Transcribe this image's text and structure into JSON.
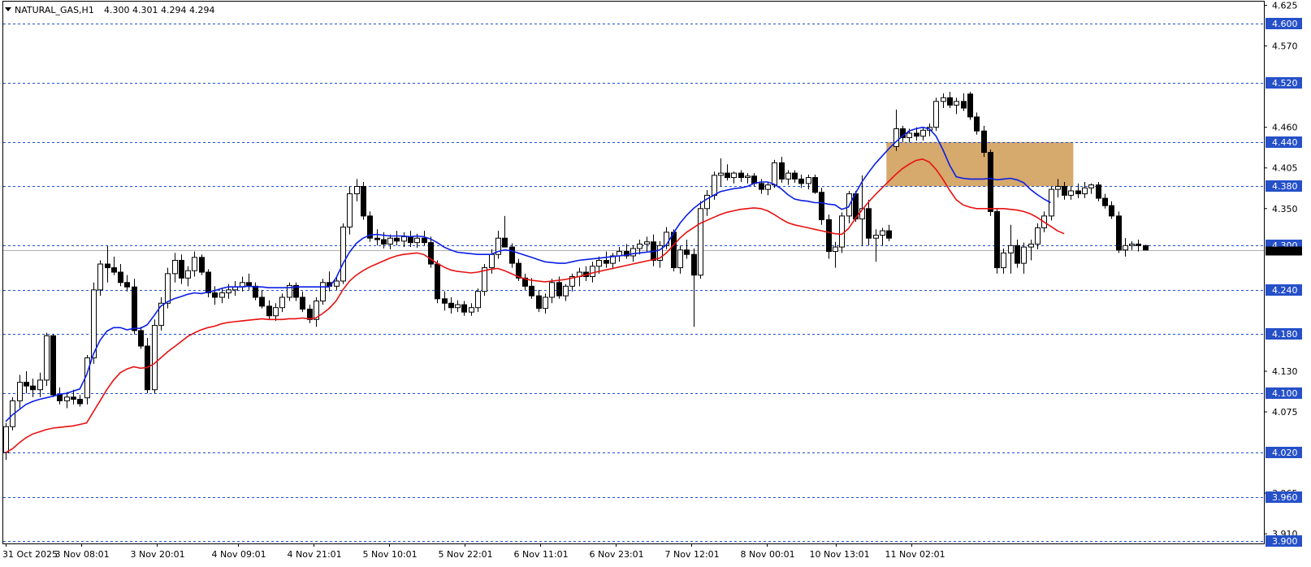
{
  "header": {
    "symbol_label": "NATURAL_GAS,H1",
    "ohlc_label": "4.300 4.301 4.294 4.294",
    "menu_icon": "triangle-down-icon"
  },
  "chart_data": {
    "type": "candlestick",
    "symbol": "NATURAL_GAS",
    "timeframe": "H1",
    "last_ohlc": {
      "open": 4.3,
      "high": 4.301,
      "low": 4.294,
      "close": 4.294
    },
    "ylim": [
      3.897,
      4.63
    ],
    "y_ticks": [
      "4.625",
      "4.570",
      "4.460",
      "4.405",
      "4.350",
      "4.130",
      "4.075",
      "3.965",
      "3.910"
    ],
    "x_ticks": [
      "31 Oct 2025",
      "3 Nov 08:01",
      "3 Nov 20:01",
      "4 Nov 09:01",
      "4 Nov 21:01",
      "5 Nov 10:01",
      "5 Nov 22:01",
      "6 Nov 11:01",
      "6 Nov 23:01",
      "7 Nov 12:01",
      "8 Nov 00:01",
      "10 Nov 13:01",
      "11 Nov 02:01"
    ],
    "hlines": [
      {
        "price": 4.6,
        "label": "4.600"
      },
      {
        "price": 4.52,
        "label": "4.520"
      },
      {
        "price": 4.44,
        "label": "4.440"
      },
      {
        "price": 4.38,
        "label": "4.380"
      },
      {
        "price": 4.3,
        "label": "4.300"
      },
      {
        "price": 4.24,
        "label": "4.240"
      },
      {
        "price": 4.18,
        "label": "4.180"
      },
      {
        "price": 4.1,
        "label": "4.100"
      },
      {
        "price": 4.02,
        "label": "4.020"
      },
      {
        "price": 3.96,
        "label": "3.960"
      },
      {
        "price": 3.9,
        "label": "3.900"
      }
    ],
    "current_price": 4.294,
    "zone": {
      "bar_start": 131,
      "bar_end": 158,
      "price_low": 4.38,
      "price_high": 4.44,
      "color": "#d6a96c"
    },
    "candles": [
      [
        4.02,
        4.06,
        4.01,
        4.055
      ],
      [
        4.055,
        4.095,
        4.05,
        4.09
      ],
      [
        4.09,
        4.125,
        4.08,
        4.115
      ],
      [
        4.115,
        4.13,
        4.1,
        4.11
      ],
      [
        4.11,
        4.12,
        4.095,
        4.105
      ],
      [
        4.105,
        4.128,
        4.095,
        4.118
      ],
      [
        4.118,
        4.182,
        4.11,
        4.178
      ],
      [
        4.178,
        4.18,
        4.095,
        4.098
      ],
      [
        4.098,
        4.108,
        4.085,
        4.09
      ],
      [
        4.09,
        4.102,
        4.08,
        4.095
      ],
      [
        4.095,
        4.105,
        4.085,
        4.092
      ],
      [
        4.092,
        4.098,
        4.082,
        4.086
      ],
      [
        4.094,
        4.152,
        4.085,
        4.148
      ],
      [
        4.148,
        4.25,
        4.14,
        4.24
      ],
      [
        4.24,
        4.28,
        4.232,
        4.275
      ],
      [
        4.275,
        4.3,
        4.25,
        4.27
      ],
      [
        4.27,
        4.285,
        4.26,
        4.264
      ],
      [
        4.264,
        4.275,
        4.245,
        4.25
      ],
      [
        4.25,
        4.26,
        4.238,
        4.244
      ],
      [
        4.244,
        4.255,
        4.18,
        4.185
      ],
      [
        4.185,
        4.19,
        4.16,
        4.164
      ],
      [
        4.164,
        4.175,
        4.1,
        4.105
      ],
      [
        4.105,
        4.2,
        4.1,
        4.192
      ],
      [
        4.192,
        4.23,
        4.185,
        4.222
      ],
      [
        4.222,
        4.27,
        4.215,
        4.262
      ],
      [
        4.262,
        4.29,
        4.25,
        4.28
      ],
      [
        4.28,
        4.288,
        4.248,
        4.256
      ],
      [
        4.256,
        4.272,
        4.245,
        4.266
      ],
      [
        4.266,
        4.292,
        4.258,
        4.284
      ],
      [
        4.284,
        4.288,
        4.26,
        4.264
      ],
      [
        4.264,
        4.268,
        4.23,
        4.236
      ],
      [
        4.236,
        4.245,
        4.22,
        4.23
      ],
      [
        4.23,
        4.242,
        4.222,
        4.236
      ],
      [
        4.236,
        4.248,
        4.228,
        4.24
      ],
      [
        4.24,
        4.252,
        4.232,
        4.244
      ],
      [
        4.244,
        4.258,
        4.238,
        4.25
      ],
      [
        4.25,
        4.262,
        4.24,
        4.245
      ],
      [
        4.245,
        4.25,
        4.226,
        4.23
      ],
      [
        4.23,
        4.24,
        4.215,
        4.218
      ],
      [
        4.218,
        4.226,
        4.2,
        4.205
      ],
      [
        4.205,
        4.222,
        4.198,
        4.216
      ],
      [
        4.216,
        4.235,
        4.21,
        4.23
      ],
      [
        4.23,
        4.25,
        4.225,
        4.246
      ],
      [
        4.246,
        4.25,
        4.225,
        4.23
      ],
      [
        4.23,
        4.238,
        4.21,
        4.214
      ],
      [
        4.214,
        4.22,
        4.195,
        4.2
      ],
      [
        4.2,
        4.23,
        4.19,
        4.225
      ],
      [
        4.225,
        4.255,
        4.22,
        4.25
      ],
      [
        4.25,
        4.265,
        4.238,
        4.245
      ],
      [
        4.245,
        4.258,
        4.24,
        4.252
      ],
      [
        4.252,
        4.33,
        4.248,
        4.325
      ],
      [
        4.325,
        4.38,
        4.315,
        4.37
      ],
      [
        4.37,
        4.39,
        4.36,
        4.38
      ],
      [
        4.38,
        4.386,
        4.335,
        4.34
      ],
      [
        4.34,
        4.346,
        4.305,
        4.31
      ],
      [
        4.31,
        4.322,
        4.3,
        4.308
      ],
      [
        4.308,
        4.318,
        4.296,
        4.302
      ],
      [
        4.302,
        4.315,
        4.295,
        4.31
      ],
      [
        4.31,
        4.32,
        4.3,
        4.306
      ],
      [
        4.306,
        4.318,
        4.298,
        4.312
      ],
      [
        4.312,
        4.32,
        4.298,
        4.304
      ],
      [
        4.304,
        4.316,
        4.297,
        4.31
      ],
      [
        4.31,
        4.32,
        4.3,
        4.304
      ],
      [
        4.304,
        4.312,
        4.27,
        4.275
      ],
      [
        4.275,
        4.28,
        4.222,
        4.228
      ],
      [
        4.228,
        4.238,
        4.212,
        4.222
      ],
      [
        4.222,
        4.23,
        4.208,
        4.216
      ],
      [
        4.216,
        4.226,
        4.21,
        4.22
      ],
      [
        4.22,
        4.225,
        4.205,
        4.21
      ],
      [
        4.21,
        4.222,
        4.205,
        4.216
      ],
      [
        4.216,
        4.242,
        4.21,
        4.238
      ],
      [
        4.238,
        4.275,
        4.232,
        4.27
      ],
      [
        4.27,
        4.295,
        4.262,
        4.288
      ],
      [
        4.288,
        4.32,
        4.282,
        4.31
      ],
      [
        4.31,
        4.34,
        4.3,
        4.298
      ],
      [
        4.298,
        4.303,
        4.27,
        4.276
      ],
      [
        4.276,
        4.282,
        4.252,
        4.256
      ],
      [
        4.256,
        4.262,
        4.24,
        4.245
      ],
      [
        4.245,
        4.256,
        4.228,
        4.232
      ],
      [
        4.232,
        4.24,
        4.21,
        4.215
      ],
      [
        4.215,
        4.235,
        4.208,
        4.23
      ],
      [
        4.23,
        4.255,
        4.222,
        4.25
      ],
      [
        4.25,
        4.258,
        4.228,
        4.232
      ],
      [
        4.232,
        4.248,
        4.225,
        4.245
      ],
      [
        4.245,
        4.262,
        4.238,
        4.258
      ],
      [
        4.258,
        4.27,
        4.245,
        4.264
      ],
      [
        4.264,
        4.272,
        4.252,
        4.258
      ],
      [
        4.258,
        4.278,
        4.25,
        4.272
      ],
      [
        4.272,
        4.285,
        4.262,
        4.28
      ],
      [
        4.28,
        4.292,
        4.27,
        4.276
      ],
      [
        4.276,
        4.29,
        4.268,
        4.286
      ],
      [
        4.286,
        4.298,
        4.278,
        4.292
      ],
      [
        4.292,
        4.302,
        4.282,
        4.286
      ],
      [
        4.286,
        4.3,
        4.278,
        4.296
      ],
      [
        4.296,
        4.308,
        4.288,
        4.302
      ],
      [
        4.302,
        4.312,
        4.292,
        4.305
      ],
      [
        4.305,
        4.315,
        4.272,
        4.28
      ],
      [
        4.28,
        4.306,
        4.27,
        4.3
      ],
      [
        4.3,
        4.325,
        4.295,
        4.318
      ],
      [
        4.318,
        4.322,
        4.265,
        4.27
      ],
      [
        4.27,
        4.3,
        4.262,
        4.294
      ],
      [
        4.294,
        4.308,
        4.282,
        4.288
      ],
      [
        4.288,
        4.296,
        4.19,
        4.26
      ],
      [
        4.26,
        4.36,
        4.255,
        4.35
      ],
      [
        4.35,
        4.375,
        4.34,
        4.368
      ],
      [
        4.368,
        4.4,
        4.362,
        4.395
      ],
      [
        4.395,
        4.418,
        4.38,
        4.398
      ],
      [
        4.398,
        4.41,
        4.388,
        4.392
      ],
      [
        4.392,
        4.4,
        4.384,
        4.398
      ],
      [
        4.398,
        4.402,
        4.386,
        4.392
      ],
      [
        4.392,
        4.398,
        4.384,
        4.394
      ],
      [
        4.394,
        4.398,
        4.38,
        4.384
      ],
      [
        4.384,
        4.39,
        4.37,
        4.376
      ],
      [
        4.376,
        4.386,
        4.368,
        4.382
      ],
      [
        4.382,
        4.416,
        4.378,
        4.412
      ],
      [
        4.412,
        4.42,
        4.385,
        4.39
      ],
      [
        4.39,
        4.402,
        4.382,
        4.398
      ],
      [
        4.398,
        4.402,
        4.385,
        4.39
      ],
      [
        4.39,
        4.396,
        4.378,
        4.384
      ],
      [
        4.384,
        4.396,
        4.376,
        4.392
      ],
      [
        4.392,
        4.396,
        4.37,
        4.372
      ],
      [
        4.372,
        4.378,
        4.328,
        4.335
      ],
      [
        4.335,
        4.342,
        4.282,
        4.292
      ],
      [
        4.292,
        4.305,
        4.27,
        4.298
      ],
      [
        4.298,
        4.345,
        4.29,
        4.34
      ],
      [
        4.34,
        4.374,
        4.33,
        4.37
      ],
      [
        4.37,
        4.374,
        4.332,
        4.336
      ],
      [
        4.336,
        4.395,
        4.3,
        4.35
      ],
      [
        4.35,
        4.362,
        4.3,
        4.31
      ],
      [
        4.31,
        4.322,
        4.278,
        4.314
      ],
      [
        4.314,
        4.324,
        4.3,
        4.32
      ],
      [
        4.32,
        4.328,
        4.306,
        4.31
      ],
      [
        4.434,
        4.484,
        4.428,
        4.458
      ],
      [
        4.458,
        4.462,
        4.44,
        4.446
      ],
      [
        4.446,
        4.458,
        4.44,
        4.452
      ],
      [
        4.452,
        4.46,
        4.442,
        4.448
      ],
      [
        4.448,
        4.46,
        4.442,
        4.456
      ],
      [
        4.456,
        4.465,
        4.448,
        4.46
      ],
      [
        4.46,
        4.5,
        4.455,
        4.495
      ],
      [
        4.495,
        4.506,
        4.486,
        4.5
      ],
      [
        4.5,
        4.508,
        4.486,
        4.49
      ],
      [
        4.49,
        4.5,
        4.478,
        4.495
      ],
      [
        4.495,
        4.506,
        4.482,
        4.486
      ],
      [
        4.505,
        4.508,
        4.47,
        4.474
      ],
      [
        4.474,
        4.48,
        4.45,
        4.455
      ],
      [
        4.455,
        4.462,
        4.42,
        4.426
      ],
      [
        4.426,
        4.43,
        4.34,
        4.346
      ],
      [
        4.346,
        4.35,
        4.262,
        4.27
      ],
      [
        4.27,
        4.296,
        4.262,
        4.29
      ],
      [
        4.29,
        4.328,
        4.262,
        4.3
      ],
      [
        4.3,
        4.308,
        4.27,
        4.276
      ],
      [
        4.276,
        4.304,
        4.262,
        4.298
      ],
      [
        4.298,
        4.308,
        4.28,
        4.302
      ],
      [
        4.302,
        4.33,
        4.295,
        4.324
      ],
      [
        4.324,
        4.346,
        4.318,
        4.34
      ],
      [
        4.34,
        4.38,
        4.334,
        4.376
      ],
      [
        4.376,
        4.39,
        4.365,
        4.38
      ],
      [
        4.38,
        4.386,
        4.362,
        4.368
      ],
      [
        4.368,
        4.38,
        4.362,
        4.374
      ],
      [
        4.374,
        4.384,
        4.364,
        4.37
      ],
      [
        4.37,
        4.386,
        4.364,
        4.378
      ],
      [
        4.378,
        4.384,
        4.37,
        4.382
      ],
      [
        4.382,
        4.386,
        4.36,
        4.364
      ],
      [
        4.364,
        4.37,
        4.35,
        4.354
      ],
      [
        4.354,
        4.36,
        4.336,
        4.34
      ],
      [
        4.34,
        4.346,
        4.29,
        4.294
      ],
      [
        4.294,
        4.31,
        4.285,
        4.3
      ],
      [
        4.3,
        4.306,
        4.294,
        4.302
      ],
      [
        4.302,
        4.308,
        4.292,
        4.3
      ],
      [
        4.3,
        4.301,
        4.294,
        4.294
      ]
    ],
    "series": [
      {
        "name": "",
        "color": "#0a1ee6",
        "values": [
          4.062,
          4.071,
          4.078,
          4.085,
          4.089,
          4.092,
          4.094,
          4.096,
          4.099,
          4.1,
          4.103,
          4.106,
          4.125,
          4.153,
          4.172,
          4.184,
          4.189,
          4.189,
          4.186,
          4.188,
          4.188,
          4.193,
          4.205,
          4.218,
          4.224,
          4.228,
          4.231,
          4.234,
          4.236,
          4.235,
          4.237,
          4.239,
          4.242,
          4.244,
          4.244,
          4.244,
          4.245,
          4.244,
          4.244,
          4.243,
          4.243,
          4.243,
          4.243,
          4.244,
          4.244,
          4.244,
          4.244,
          4.244,
          4.244,
          4.256,
          4.275,
          4.291,
          4.303,
          4.31,
          4.314,
          4.315,
          4.314,
          4.313,
          4.313,
          4.313,
          4.312,
          4.313,
          4.312,
          4.309,
          4.304,
          4.298,
          4.294,
          4.291,
          4.29,
          4.289,
          4.288,
          4.288,
          4.288,
          4.292,
          4.294,
          4.293,
          4.29,
          4.287,
          4.284,
          4.281,
          4.278,
          4.277,
          4.276,
          4.276,
          4.278,
          4.28,
          4.281,
          4.282,
          4.283,
          4.284,
          4.285,
          4.286,
          4.287,
          4.289,
          4.29,
          4.291,
          4.292,
          4.294,
          4.301,
          4.316,
          4.33,
          4.341,
          4.35,
          4.357,
          4.363,
          4.368,
          4.373,
          4.375,
          4.377,
          4.378,
          4.38,
          4.384,
          4.386,
          4.386,
          4.383,
          4.377,
          4.369,
          4.363,
          4.361,
          4.36,
          4.358,
          4.358,
          4.356,
          4.355,
          4.349,
          4.352,
          4.37,
          4.386,
          4.399,
          4.411,
          4.421,
          4.431,
          4.44,
          4.448,
          4.455,
          4.458,
          4.46,
          4.458,
          4.448,
          4.43,
          4.409,
          4.393,
          4.391,
          4.39,
          4.39,
          4.39,
          4.391,
          4.389,
          4.39,
          4.391,
          4.389,
          4.385,
          4.376,
          4.369,
          4.363,
          4.358
        ]
      },
      {
        "name": "",
        "color": "#e81010",
        "values": [
          4.02,
          4.025,
          4.033,
          4.04,
          4.045,
          4.048,
          4.051,
          4.053,
          4.054,
          4.055,
          4.056,
          4.058,
          4.06,
          4.075,
          4.09,
          4.105,
          4.118,
          4.128,
          4.133,
          4.136,
          4.134,
          4.135,
          4.14,
          4.148,
          4.156,
          4.163,
          4.17,
          4.177,
          4.182,
          4.186,
          4.189,
          4.191,
          4.194,
          4.196,
          4.197,
          4.198,
          4.199,
          4.2,
          4.201,
          4.2,
          4.2,
          4.2,
          4.201,
          4.201,
          4.202,
          4.201,
          4.202,
          4.208,
          4.215,
          4.225,
          4.24,
          4.252,
          4.26,
          4.266,
          4.271,
          4.275,
          4.279,
          4.283,
          4.286,
          4.288,
          4.289,
          4.29,
          4.288,
          4.282,
          4.276,
          4.271,
          4.267,
          4.265,
          4.264,
          4.263,
          4.264,
          4.266,
          4.268,
          4.269,
          4.266,
          4.262,
          4.258,
          4.255,
          4.253,
          4.252,
          4.251,
          4.252,
          4.253,
          4.254,
          4.256,
          4.258,
          4.26,
          4.263,
          4.265,
          4.267,
          4.269,
          4.271,
          4.273,
          4.275,
          4.277,
          4.279,
          4.281,
          4.283,
          4.29,
          4.3,
          4.31,
          4.318,
          4.324,
          4.33,
          4.334,
          4.338,
          4.342,
          4.345,
          4.347,
          4.349,
          4.35,
          4.351,
          4.35,
          4.347,
          4.342,
          4.336,
          4.331,
          4.328,
          4.326,
          4.324,
          4.322,
          4.32,
          4.318,
          4.316,
          4.315,
          4.323,
          4.336,
          4.348,
          4.359,
          4.369,
          4.378,
          4.387,
          4.396,
          4.404,
          4.41,
          4.415,
          4.417,
          4.413,
          4.403,
          4.39,
          4.375,
          4.362,
          4.355,
          4.352,
          4.35,
          4.35,
          4.35,
          4.35,
          4.35,
          4.349,
          4.348,
          4.346,
          4.343,
          4.338,
          4.332,
          4.326,
          4.32,
          4.316
        ]
      }
    ]
  }
}
